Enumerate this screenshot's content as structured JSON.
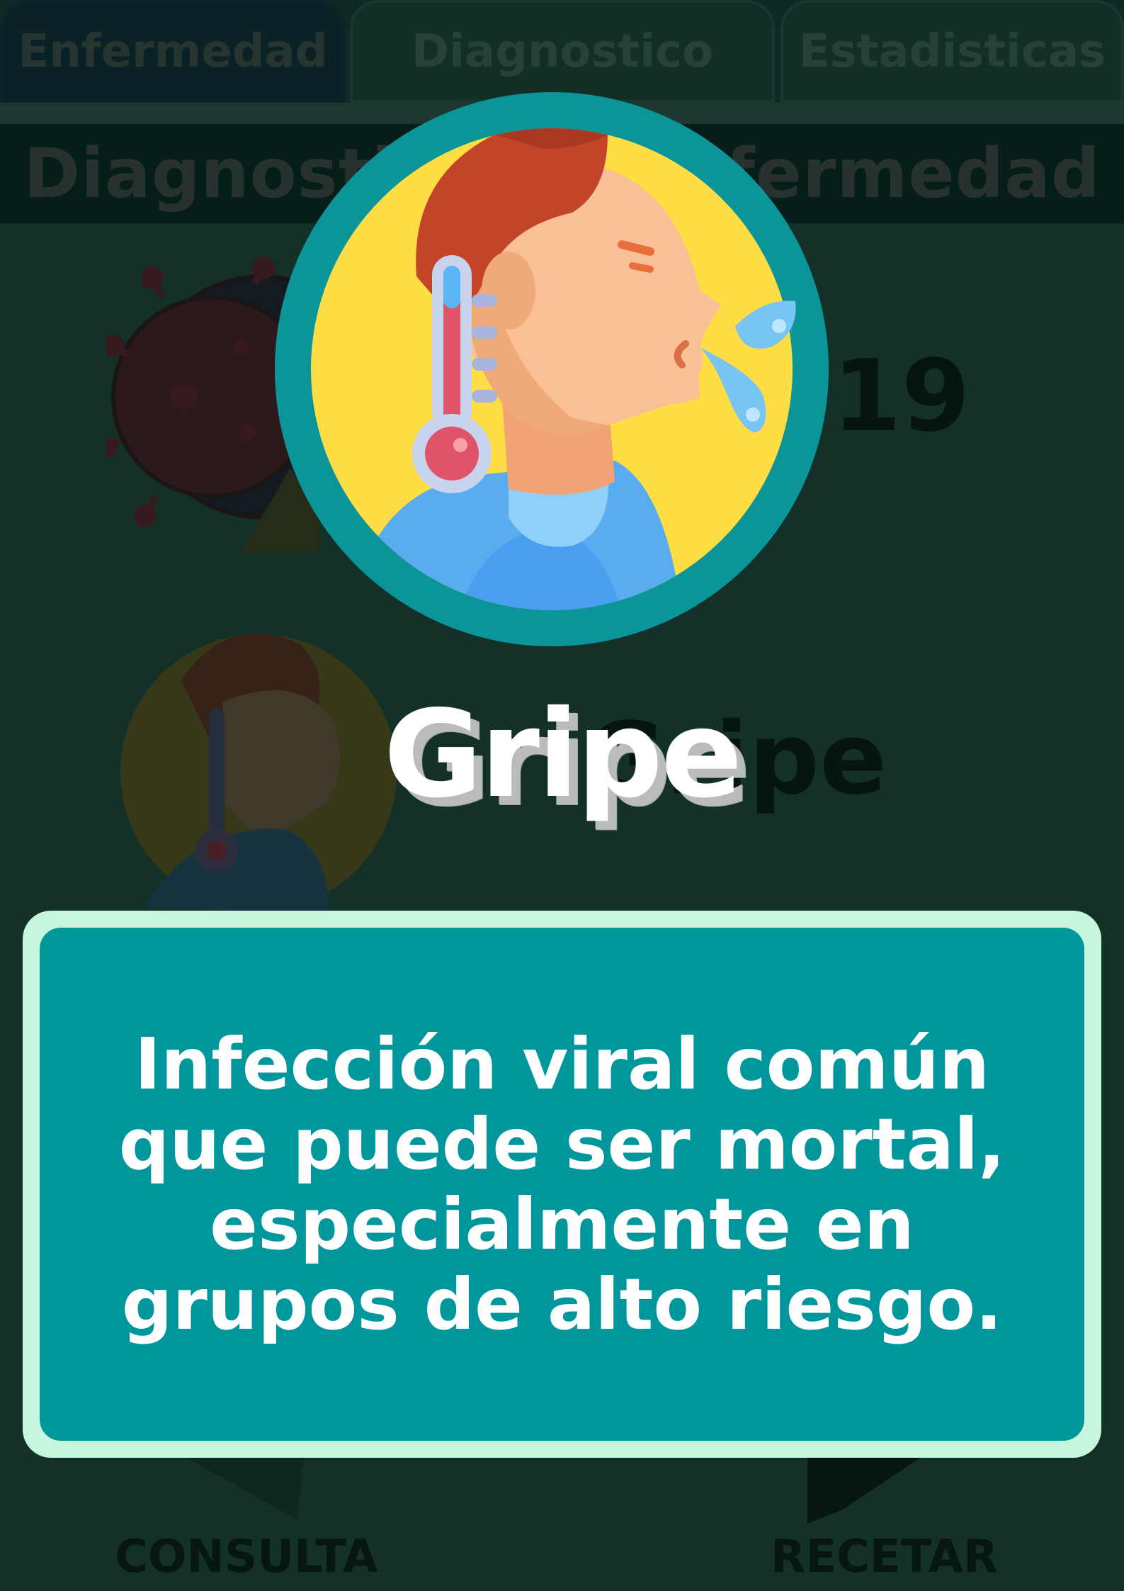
{
  "tabs": [
    {
      "label": "Enfermedad",
      "active": true
    },
    {
      "label": "Diagnostico",
      "active": false
    },
    {
      "label": "Estadisticas",
      "active": false
    }
  ],
  "section_header": "Diagnostico de Enfermedad",
  "list": [
    {
      "label": "Covid-19",
      "icon": "virus-warning-icon"
    },
    {
      "label": "Gripe",
      "icon": "fever-man-icon"
    }
  ],
  "actions": {
    "consulta_label": "CONSULTA",
    "recetar_label": "RECETAR"
  },
  "popup": {
    "title": "Gripe",
    "icon": "fever-man-thermometer-icon",
    "description": "Infección viral común que puede ser mortal, especialmente en grupos de alto riesgo."
  },
  "colors": {
    "card_border": "#c6f7dc",
    "card_fill": "#00979c",
    "icon_ring": "#0b9599",
    "icon_bg": "#ffdd44"
  }
}
